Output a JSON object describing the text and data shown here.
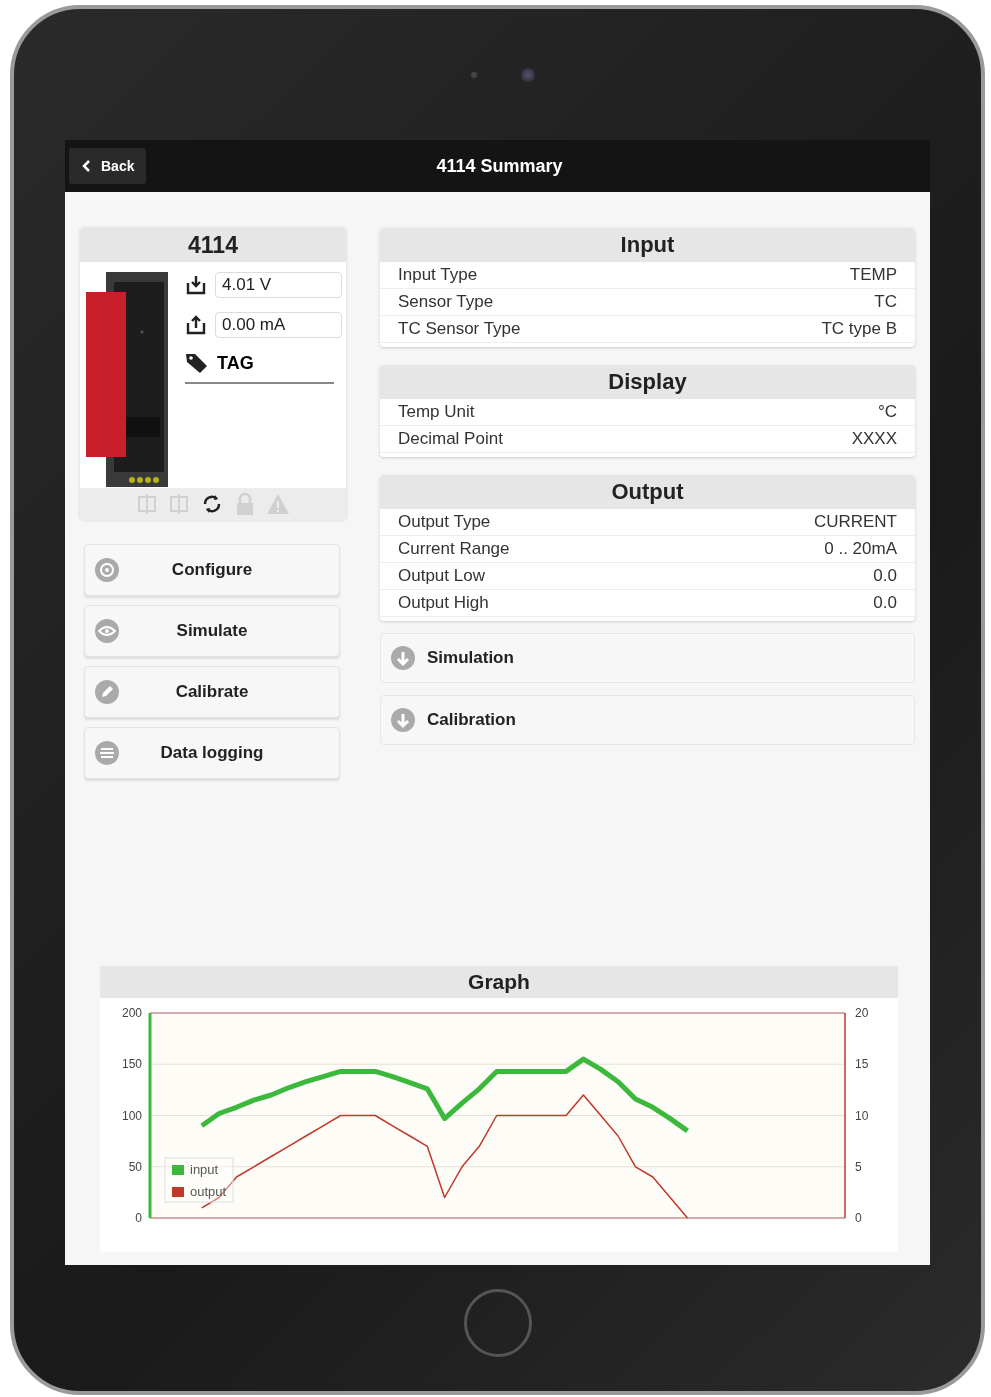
{
  "nav_bar": {
    "back_label": "Back",
    "title": "4114 Summary"
  },
  "device_card": {
    "title": "4114",
    "values": [
      {
        "kind": "input",
        "value": "4.01 V"
      },
      {
        "kind": "output",
        "value": "0.00 mA"
      }
    ],
    "tag": "TAG",
    "status_icons": [
      {
        "kind": "plug",
        "active": false
      },
      {
        "kind": "plug",
        "active": false
      },
      {
        "kind": "sync",
        "active": true
      },
      {
        "kind": "lock",
        "active": false
      },
      {
        "kind": "warning",
        "active": false
      }
    ]
  },
  "actions": [
    {
      "kind": "configure",
      "label": "Configure"
    },
    {
      "kind": "simulate",
      "label": "Simulate"
    },
    {
      "kind": "calibrate",
      "label": "Calibrate"
    },
    {
      "kind": "log",
      "label": "Data logging"
    }
  ],
  "sections": [
    {
      "title": "Input",
      "rows": [
        {
          "label": "Input Type",
          "value": "TEMP"
        },
        {
          "label": "Sensor Type",
          "value": "TC"
        },
        {
          "label": "TC Sensor Type",
          "value": "TC type B"
        }
      ]
    },
    {
      "title": "Display",
      "rows": [
        {
          "label": "Temp Unit",
          "value": "°C"
        },
        {
          "label": "Decimal Point",
          "value": "XXXX"
        }
      ]
    },
    {
      "title": "Output",
      "rows": [
        {
          "label": "Output Type",
          "value": "CURRENT"
        },
        {
          "label": "Current Range",
          "value": "0 .. 20mA"
        },
        {
          "label": "Output Low",
          "value": "0.0"
        },
        {
          "label": "Output High",
          "value": "0.0"
        }
      ]
    }
  ],
  "collapsibles": [
    {
      "title": "Simulation",
      "expanded": false
    },
    {
      "title": "Calibration",
      "expanded": false
    }
  ],
  "graph": {
    "title": "Graph",
    "chart_data": {
      "type": "line",
      "ylim": [
        0,
        200
      ],
      "yticks": [
        0,
        50,
        100,
        150,
        200
      ],
      "y2lim": [
        0,
        20
      ],
      "y2ticks": [
        0,
        5,
        10,
        15,
        20
      ],
      "grid": true,
      "legend": "lower left",
      "series": [
        {
          "name": "input",
          "color": "#3cb83c",
          "axis": "y",
          "values": [
            90,
            102,
            108,
            115,
            120,
            127,
            133,
            138,
            143,
            143,
            143,
            138,
            132,
            126,
            97,
            112,
            126,
            143,
            143,
            143,
            143,
            143,
            155,
            145,
            133,
            116,
            108,
            97,
            85
          ]
        },
        {
          "name": "output",
          "color": "#c0392b",
          "axis": "y2",
          "values": [
            1,
            2,
            4,
            5,
            6,
            7,
            8,
            9,
            10,
            10,
            10,
            9,
            8,
            7,
            2,
            5,
            7,
            10,
            10,
            10,
            10,
            10,
            12,
            10,
            8,
            5,
            4,
            2,
            0
          ]
        }
      ]
    }
  }
}
